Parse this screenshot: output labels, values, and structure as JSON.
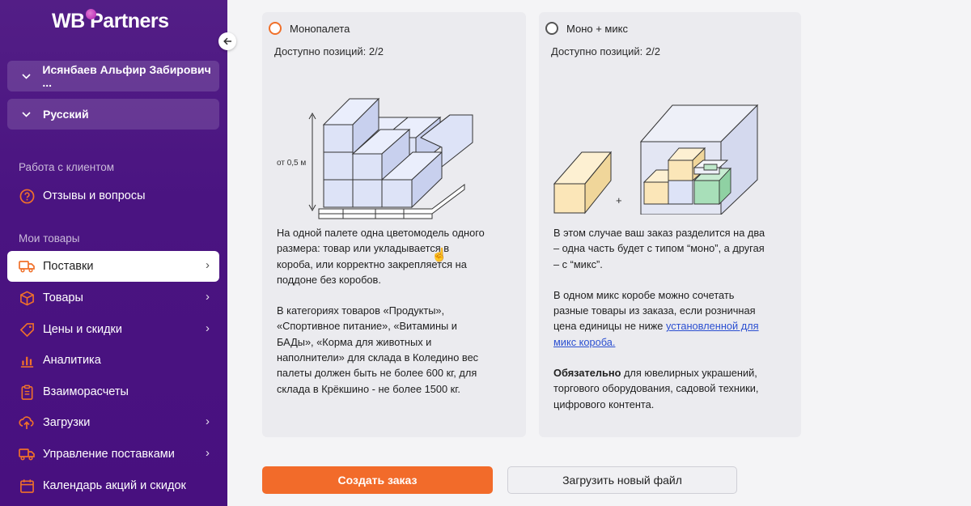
{
  "brand": {
    "wb": "WB",
    "partners": "Partners"
  },
  "user": {
    "name": "Исянбаев Альфир Забирович ..."
  },
  "language": {
    "value": "Русский"
  },
  "sections": {
    "client": "Работа с клиентом",
    "goods": "Мои товары"
  },
  "nav": {
    "reviews": "Отзывы и вопросы",
    "supplies": "Поставки",
    "products": "Товары",
    "prices": "Цены и скидки",
    "analytics": "Аналитика",
    "settlements": "Взаиморасчеты",
    "uploads": "Загрузки",
    "supply_mgmt": "Управление поставками",
    "calendar": "Календарь акций и скидок"
  },
  "mono": {
    "title": "Монопалета",
    "available": "Доступно позиций: 2/2",
    "height_label": "от 0,5 м",
    "para1": "На одной палете одна цветомодель одного размера: товар или укладывается в короба, или корректно закрепляется на поддоне без коробов.",
    "para2": "В категориях товаров «Продукты», «Спортивное питание», «Витамины и БАДы», «Корма для животных и наполнители» для склада в Коледино вес палеты должен быть не более 600 кг, для склада в Крёкшино - не более 1500 кг."
  },
  "mix": {
    "title": "Моно + микс",
    "available": "Доступно позиций: 2/2",
    "plus": "+",
    "para1": "В этом случае ваш заказ разделится на два – одна часть будет с типом “моно”, а другая – с “микс”.",
    "para2_prefix": "В одном микс коробе можно сочетать разные товары из заказа, если розничная цена единицы не ниже",
    "para2_link": "установленной для микс короба.",
    "para3_bold": "Обязательно",
    "para3_rest": " для ювелирных украшений, торгового оборудования, садовой техники, цифрового контента."
  },
  "buttons": {
    "create": "Создать заказ",
    "upload": "Загрузить новый файл"
  },
  "colors": {
    "sidebar": "#4a1481",
    "accent": "#f26b2a",
    "brand_dot": "#cb11ab"
  }
}
